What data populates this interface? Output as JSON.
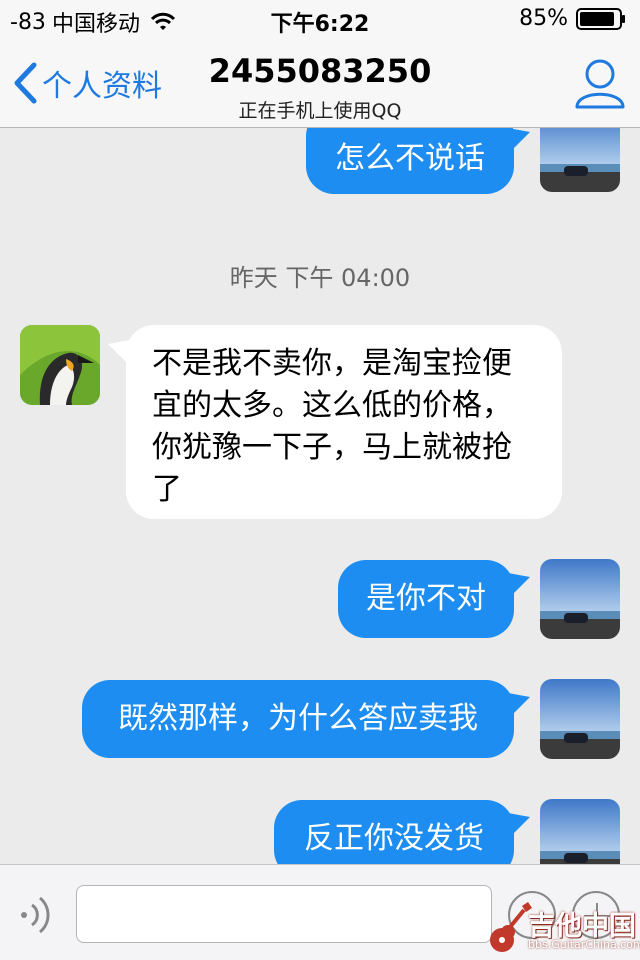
{
  "status_bar": {
    "signal": "-83",
    "carrier": "中国移动",
    "time": "下午6:22",
    "battery": "85%"
  },
  "nav": {
    "back_label": "个人资料",
    "title": "2455083250",
    "subtitle": "正在手机上使用QQ"
  },
  "chat": {
    "messages": [
      {
        "text": "怎么不说话",
        "direction": "out"
      },
      {
        "text": "不是我不卖你，是淘宝捡便宜的太多。这么低的价格，你犹豫一下子，马上就被抢了",
        "direction": "in"
      },
      {
        "text": "是你不对",
        "direction": "out"
      },
      {
        "text": "既然那样，为什么答应卖我",
        "direction": "out"
      },
      {
        "text": "反正你没发货",
        "direction": "out"
      }
    ],
    "timestamp": "昨天 下午 04:00"
  },
  "input_bar": {
    "message_value": "",
    "message_placeholder": ""
  },
  "watermark": {
    "text": "吉他中国",
    "url": "bbs.GuitarChina.com"
  },
  "colors": {
    "outgoing_bubble": "#1d8df1",
    "accent": "#1f7ae0",
    "background": "#ebebeb"
  }
}
